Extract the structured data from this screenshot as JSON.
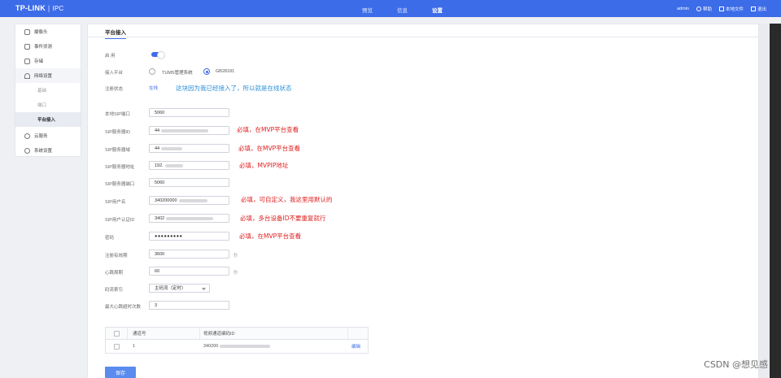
{
  "header": {
    "logo": "TP-LINK",
    "product": "IPC",
    "nav": [
      "预览",
      "信息",
      "设置"
    ],
    "active_nav": "设置",
    "user": "admin",
    "help": "帮助",
    "local_files": "本地文件",
    "logout": "退出"
  },
  "sidebar": {
    "items": [
      {
        "label": "摄像头",
        "icon": "camera-icon"
      },
      {
        "label": "事件侦测",
        "icon": "event-icon"
      },
      {
        "label": "存储",
        "icon": "storage-icon"
      },
      {
        "label": "网络设置",
        "icon": "wifi-icon"
      },
      {
        "label": "云服务",
        "icon": "cloud-icon"
      },
      {
        "label": "系统设置",
        "icon": "gear-icon"
      }
    ],
    "subitems": [
      "基础",
      "端口",
      "平台接入"
    ],
    "active_sub": "平台接入"
  },
  "tab": "平台接入",
  "form": {
    "enable_label": "启 用",
    "enabled": true,
    "platform_label": "接入平台",
    "platform_options": [
      "TUMS管理系统",
      "GB28181"
    ],
    "platform_selected": "GB28181",
    "reg_status_label": "注册状态",
    "reg_status_value": "在线",
    "local_port_label": "本地SIP端口",
    "local_port_value": "5060",
    "server_id_label": "SIP服务器ID",
    "server_id_value": "44",
    "server_domain_label": "SIP服务器域",
    "server_domain_value": "44",
    "server_addr_label": "SIP服务器地址",
    "server_addr_value": "192.",
    "server_port_label": "SIP服务器端口",
    "server_port_value": "5060",
    "username_label": "SIP用户名",
    "username_value": "340200000",
    "user_auth_label": "SIP用户认证ID",
    "user_auth_value": "3402",
    "password_label": "密码",
    "password_value": "●●●●●●●●●",
    "expiry_label": "注册有效期",
    "expiry_value": "3600",
    "expiry_unit": "秒",
    "heartbeat_label": "心跳周期",
    "heartbeat_value": "60",
    "heartbeat_unit": "秒",
    "stream_label": "码流索引",
    "stream_value": "主码流（定时）",
    "max_timeout_label": "最大心跳超时次数",
    "max_timeout_value": "3"
  },
  "annotations": {
    "status_note": "这块因为我已经接入了，所以就是在线状态",
    "server_id_note": "必填，在MVP平台查看",
    "server_domain_note": "必填，在MVP平台查看",
    "server_addr_note": "必填，MVPIP地址",
    "username_note": "必填，可自定义，我这里用默认的",
    "user_auth_note": "必填，多台设备ID不要重复就行",
    "password_note": "必填，在MVP平台查看"
  },
  "channel_table": {
    "headers": [
      "通道号",
      "视频通道编码ID"
    ],
    "rows": [
      {
        "channel": "1",
        "code": "340200",
        "action": "编辑"
      }
    ]
  },
  "save_label": "保存",
  "watermark": "CSDN @想见感"
}
